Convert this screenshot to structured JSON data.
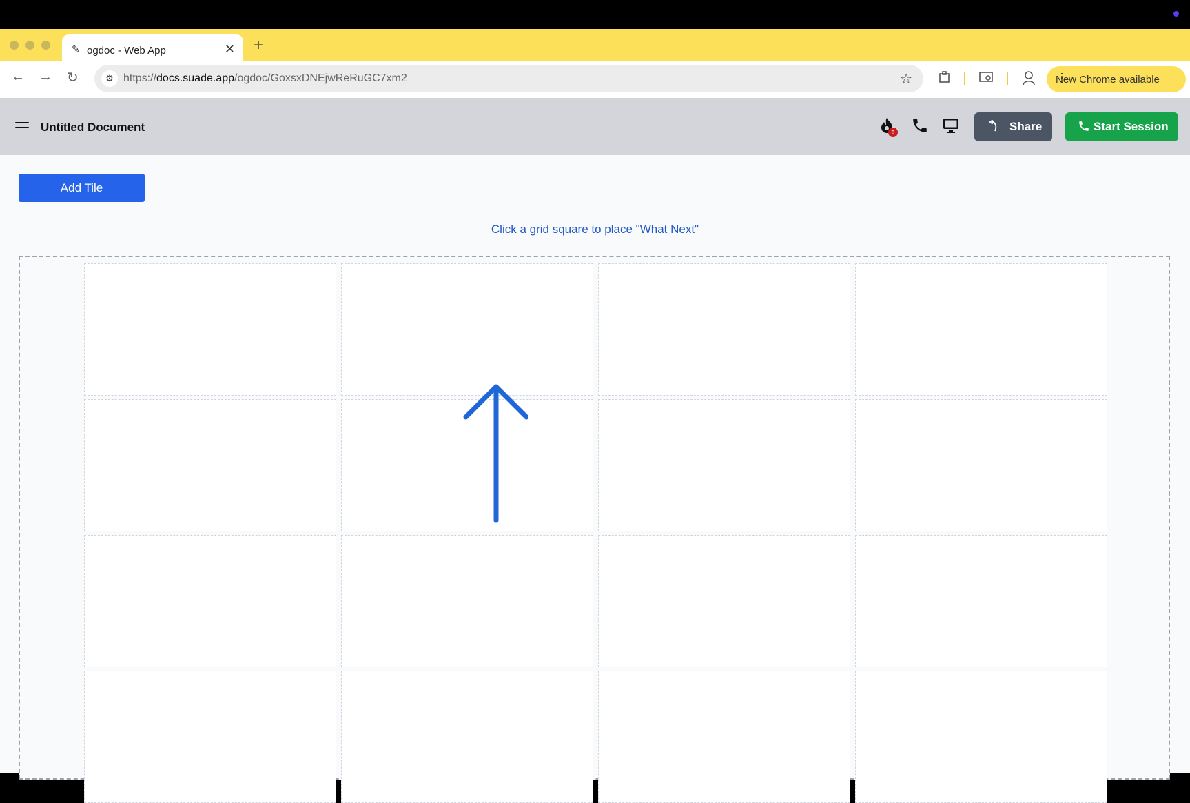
{
  "browser": {
    "tab_title": "ogdoc - Web App",
    "url_prefix": "https://",
    "url_domain": "docs.suade.app",
    "url_path": "/ogdoc/GoxsxDNEjwReRuGC7xm2",
    "update_label": "New Chrome available"
  },
  "header": {
    "doc_title": "Untitled Document",
    "notification_count": "0",
    "share_label": "Share",
    "start_session_label": "Start Session"
  },
  "main": {
    "add_tile_label": "Add Tile",
    "hint_text": "Click a grid square to place \"What Next\""
  },
  "colors": {
    "accent_blue": "#2563eb",
    "start_green": "#16a34a",
    "share_gray": "#4b5563",
    "chrome_yellow": "#fde05a",
    "arrow_blue": "#1f66d6"
  },
  "grid": {
    "rows": 4,
    "columns": 4
  }
}
